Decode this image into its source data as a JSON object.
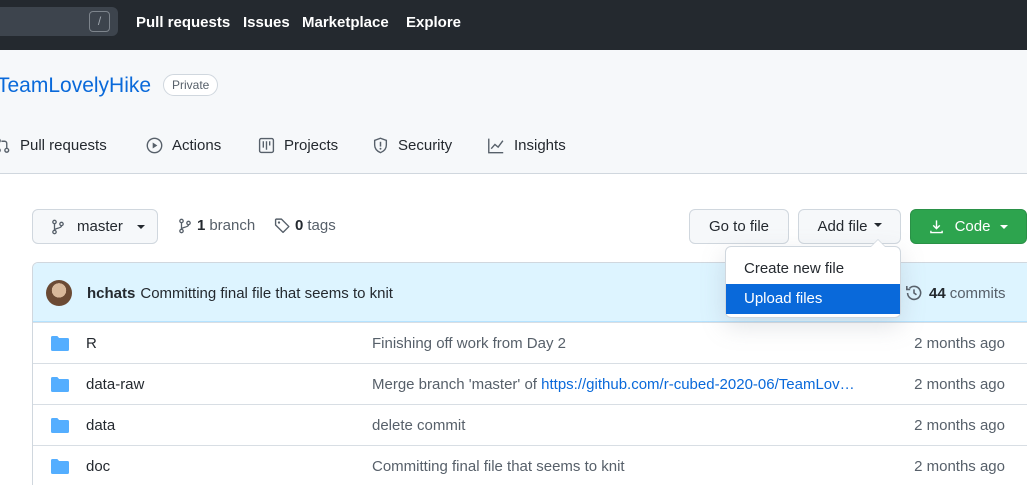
{
  "topnav": {
    "search_shortcut": "/",
    "links": [
      "Pull requests",
      "Issues",
      "Marketplace",
      "Explore"
    ]
  },
  "repo": {
    "name": "TeamLovelyHike",
    "visibility": "Private"
  },
  "tabs": [
    {
      "label": "Pull requests",
      "icon": "pull-request-icon"
    },
    {
      "label": "Actions",
      "icon": "play-icon"
    },
    {
      "label": "Projects",
      "icon": "project-icon"
    },
    {
      "label": "Security",
      "icon": "shield-icon"
    },
    {
      "label": "Insights",
      "icon": "graph-icon"
    }
  ],
  "toolbar": {
    "branch_selected": "master",
    "branch_count": "1",
    "branch_label": "branch",
    "tag_count": "0",
    "tag_label": "tags",
    "go_to_file": "Go to file",
    "add_file": "Add file",
    "code": "Code"
  },
  "dropdown": {
    "items": [
      "Create new file",
      "Upload files"
    ],
    "highlighted": "Upload files"
  },
  "latest_commit": {
    "author": "hchats",
    "message": "Committing final file that seems to knit",
    "commit_count": "44",
    "commit_label": "commits"
  },
  "files": [
    {
      "name": "R",
      "message": "Finishing off work from Day 2",
      "link": "",
      "age": "2 months ago"
    },
    {
      "name": "data-raw",
      "message": "Merge branch 'master' of ",
      "link": "https://github.com/r-cubed-2020-06/TeamLov…",
      "age": "2 months ago"
    },
    {
      "name": "data",
      "message": "delete commit",
      "link": "",
      "age": "2 months ago"
    },
    {
      "name": "doc",
      "message": "Committing final file that seems to knit",
      "link": "",
      "age": "2 months ago"
    }
  ],
  "colors": {
    "header_bg": "#24292f",
    "accent_blue": "#0969da",
    "code_green": "#2da44e",
    "folder_blue": "#54aeff"
  }
}
